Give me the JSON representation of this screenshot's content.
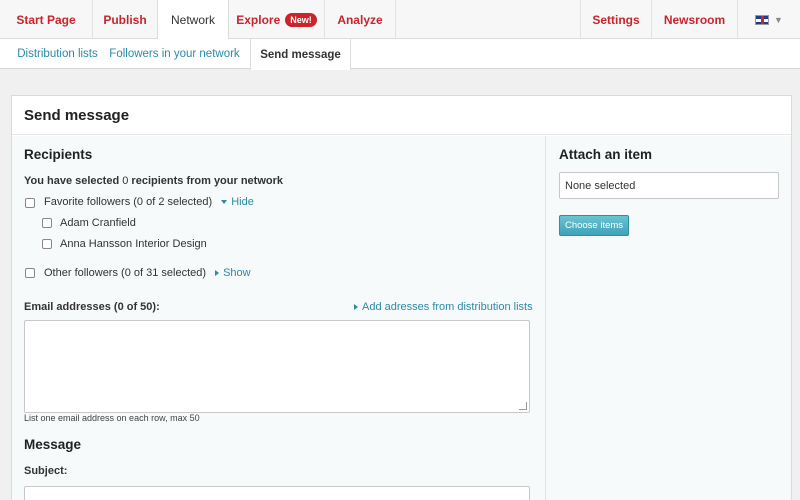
{
  "topnav": {
    "items": [
      {
        "label": "Start Page"
      },
      {
        "label": "Publish"
      },
      {
        "label": "Network"
      },
      {
        "label": "Explore",
        "badge": "New!"
      },
      {
        "label": "Analyze"
      }
    ],
    "right": [
      {
        "label": "Settings"
      },
      {
        "label": "Newsroom"
      }
    ],
    "language_icon": "uk-flag-icon"
  },
  "subnav": {
    "items": [
      {
        "label": "Distribution lists"
      },
      {
        "label": "Followers in your network"
      },
      {
        "label": "Send message"
      }
    ]
  },
  "panel": {
    "title": "Send message",
    "recipients": {
      "heading": "Recipients",
      "selected_prefix": "You have selected",
      "selected_count": "0",
      "selected_suffix": "recipients from your network",
      "favorite_label": "Favorite followers (0 of 2 selected)",
      "favorite_toggle": "Hide",
      "favorites": [
        "Adam Cranfield",
        "Anna Hansson Interior Design"
      ],
      "other_label": "Other followers (0 of 31 selected)",
      "other_toggle": "Show"
    },
    "email": {
      "label_prefix": "Email addresses",
      "count_text": "(0 of 50):",
      "add_link": "Add adresses from distribution lists",
      "help": "List one email address on each row, max 50"
    },
    "message": {
      "heading": "Message",
      "subject_label": "Subject:"
    },
    "attach": {
      "heading": "Attach an item",
      "select_value": "None selected",
      "button_label": "Choose items"
    }
  }
}
